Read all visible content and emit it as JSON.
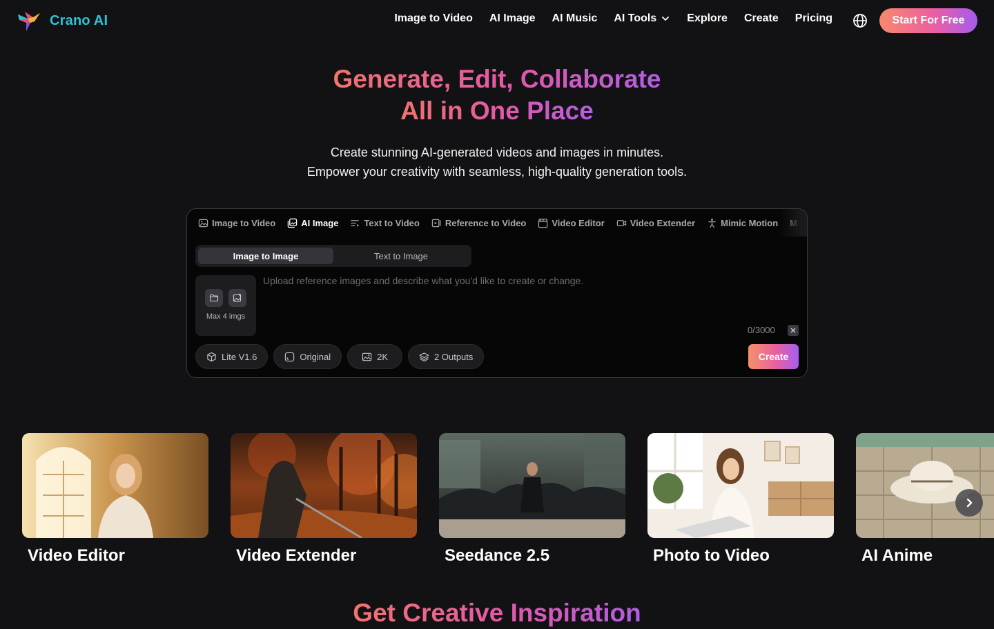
{
  "brand": {
    "name": "Crano AI",
    "logo_icon": "bird-logo"
  },
  "nav": {
    "items": [
      {
        "label": "Image to Video"
      },
      {
        "label": "AI Image"
      },
      {
        "label": "AI Music"
      },
      {
        "label": "AI Tools",
        "icon": "chevron-down-icon"
      },
      {
        "label": "Explore"
      },
      {
        "label": "Create"
      },
      {
        "label": "Pricing"
      }
    ],
    "language_icon": "globe-icon",
    "cta": "Start For Free"
  },
  "hero": {
    "title_line1": "Generate, Edit, Collaborate",
    "title_line2": "All in One Place",
    "subtitle_line1": "Create stunning AI-generated videos and images in minutes.",
    "subtitle_line2": "Empower your creativity with seamless, high-quality generation tools."
  },
  "generator": {
    "tabs": [
      {
        "label": "Image to Video",
        "icon": "image-video-icon"
      },
      {
        "label": "AI Image",
        "icon": "images-icon",
        "active": true
      },
      {
        "label": "Text to Video",
        "icon": "text-lines-icon"
      },
      {
        "label": "Reference to Video",
        "icon": "reference-video-icon"
      },
      {
        "label": "Video Editor",
        "icon": "clapperboard-icon"
      },
      {
        "label": "Video Extender",
        "icon": "video-camera-icon"
      },
      {
        "label": "Mimic Motion",
        "icon": "person-motion-icon"
      },
      {
        "label": "M"
      }
    ],
    "mode": {
      "options": [
        "Image to Image",
        "Text to Image"
      ],
      "selected": "Image to Image"
    },
    "upload": {
      "label": "Max 4 imgs",
      "icons": [
        "folder-icon",
        "image-add-icon"
      ]
    },
    "prompt": {
      "value": "",
      "placeholder": "Upload reference images and describe what you'd like to create or change."
    },
    "counter": "0/3000",
    "options": [
      {
        "label": "Lite V1.6",
        "icon": "cube-icon"
      },
      {
        "label": "Original",
        "icon": "aspect-icon"
      },
      {
        "label": "2K",
        "icon": "resolution-icon"
      },
      {
        "label": "2 Outputs",
        "icon": "layers-icon"
      }
    ],
    "create_label": "Create"
  },
  "features": [
    {
      "title": "Video Editor"
    },
    {
      "title": "Video Extender"
    },
    {
      "title": "Seedance 2.5"
    },
    {
      "title": "Photo to Video"
    },
    {
      "title": "AI Anime"
    }
  ],
  "inspiration_title": "Get Creative Inspiration"
}
